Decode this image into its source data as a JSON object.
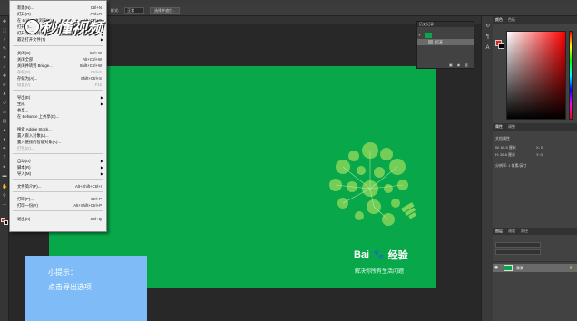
{
  "options_bar": {
    "style_label": "样式:",
    "style_value": "正常",
    "select_subject_label": "选择并遮住..."
  },
  "file_menu": {
    "items": [
      {
        "label": "新建(N)...",
        "shortcut": "Ctrl+N",
        "disabled": false,
        "submenu": false
      },
      {
        "label": "打开(O)...",
        "shortcut": "Ctrl+O",
        "disabled": false,
        "submenu": false
      },
      {
        "label": "在 Bridge 中浏览(B)...",
        "shortcut": "Alt+Ctrl+O",
        "disabled": false,
        "submenu": false
      },
      {
        "label": "打开为...",
        "shortcut": "Alt+Shift+Ctrl+O",
        "disabled": false,
        "submenu": false
      },
      {
        "label": "打开为智能对象...",
        "shortcut": "",
        "disabled": false,
        "submenu": false
      },
      {
        "label": "最近打开文件(T)",
        "shortcut": "",
        "disabled": false,
        "submenu": true
      },
      {
        "label": "关闭(C)",
        "shortcut": "Ctrl+W",
        "disabled": false,
        "submenu": false
      },
      {
        "label": "关闭全部",
        "shortcut": "Alt+Ctrl+W",
        "disabled": false,
        "submenu": false
      },
      {
        "label": "关闭并转到 Bridge...",
        "shortcut": "Shift+Ctrl+W",
        "disabled": false,
        "submenu": false
      },
      {
        "label": "存储(S)",
        "shortcut": "Ctrl+S",
        "disabled": true,
        "submenu": false
      },
      {
        "label": "存储为(A)...",
        "shortcut": "Shift+Ctrl+S",
        "disabled": false,
        "submenu": false
      },
      {
        "label": "恢复(V)",
        "shortcut": "F12",
        "disabled": true,
        "submenu": false
      },
      {
        "label": "导出(E)",
        "shortcut": "",
        "disabled": false,
        "submenu": true
      },
      {
        "label": "生成",
        "shortcut": "",
        "disabled": false,
        "submenu": true
      },
      {
        "label": "共享...",
        "shortcut": "",
        "disabled": false,
        "submenu": false
      },
      {
        "label": "在 Behance 上共享(D)...",
        "shortcut": "",
        "disabled": false,
        "submenu": false
      },
      {
        "label": "搜索 Adobe Stock...",
        "shortcut": "",
        "disabled": false,
        "submenu": false
      },
      {
        "label": "置入嵌入对象(L)...",
        "shortcut": "",
        "disabled": false,
        "submenu": false
      },
      {
        "label": "置入链接的智能对象(K)...",
        "shortcut": "",
        "disabled": false,
        "submenu": false
      },
      {
        "label": "打包(G)...",
        "shortcut": "",
        "disabled": true,
        "submenu": false
      },
      {
        "label": "自动(U)",
        "shortcut": "",
        "disabled": false,
        "submenu": true
      },
      {
        "label": "脚本(R)",
        "shortcut": "",
        "disabled": false,
        "submenu": true
      },
      {
        "label": "导入(M)",
        "shortcut": "",
        "disabled": false,
        "submenu": true
      },
      {
        "label": "文件简介(F)...",
        "shortcut": "Alt+Shift+Ctrl+I",
        "disabled": false,
        "submenu": false
      },
      {
        "label": "打印(P)...",
        "shortcut": "Ctrl+P",
        "disabled": false,
        "submenu": false
      },
      {
        "label": "打印一份(Y)",
        "shortcut": "Alt+Shift+Ctrl+P",
        "disabled": false,
        "submenu": false
      },
      {
        "label": "退出(X)",
        "shortcut": "Ctrl+Q",
        "disabled": false,
        "submenu": false
      }
    ]
  },
  "watermark": "秒懂视频",
  "tip": {
    "line1": "小提示：",
    "line2": "点击导出选项"
  },
  "canvas_art": {
    "brand_left": "Bai",
    "brand_right": "经验",
    "slogan": "解决你所有生活问题",
    "background_color": "#08a84a"
  },
  "history_panel": {
    "title": "历史记录",
    "row_label": "打开"
  },
  "right_panels": {
    "color_tabs": [
      "颜色",
      "色板"
    ],
    "props_tabs": [
      "属性",
      "调整"
    ],
    "props_title": "文档属性",
    "props_w": "W: 65.5 厘米",
    "props_h": "H: 36.8 厘米",
    "props_x": "X: 0",
    "props_y": "Y: 0",
    "props_res": "分辨率: 1 像素/英寸",
    "layer_tabs": [
      "图层",
      "通道",
      "路径"
    ],
    "layer_name": "背景"
  }
}
